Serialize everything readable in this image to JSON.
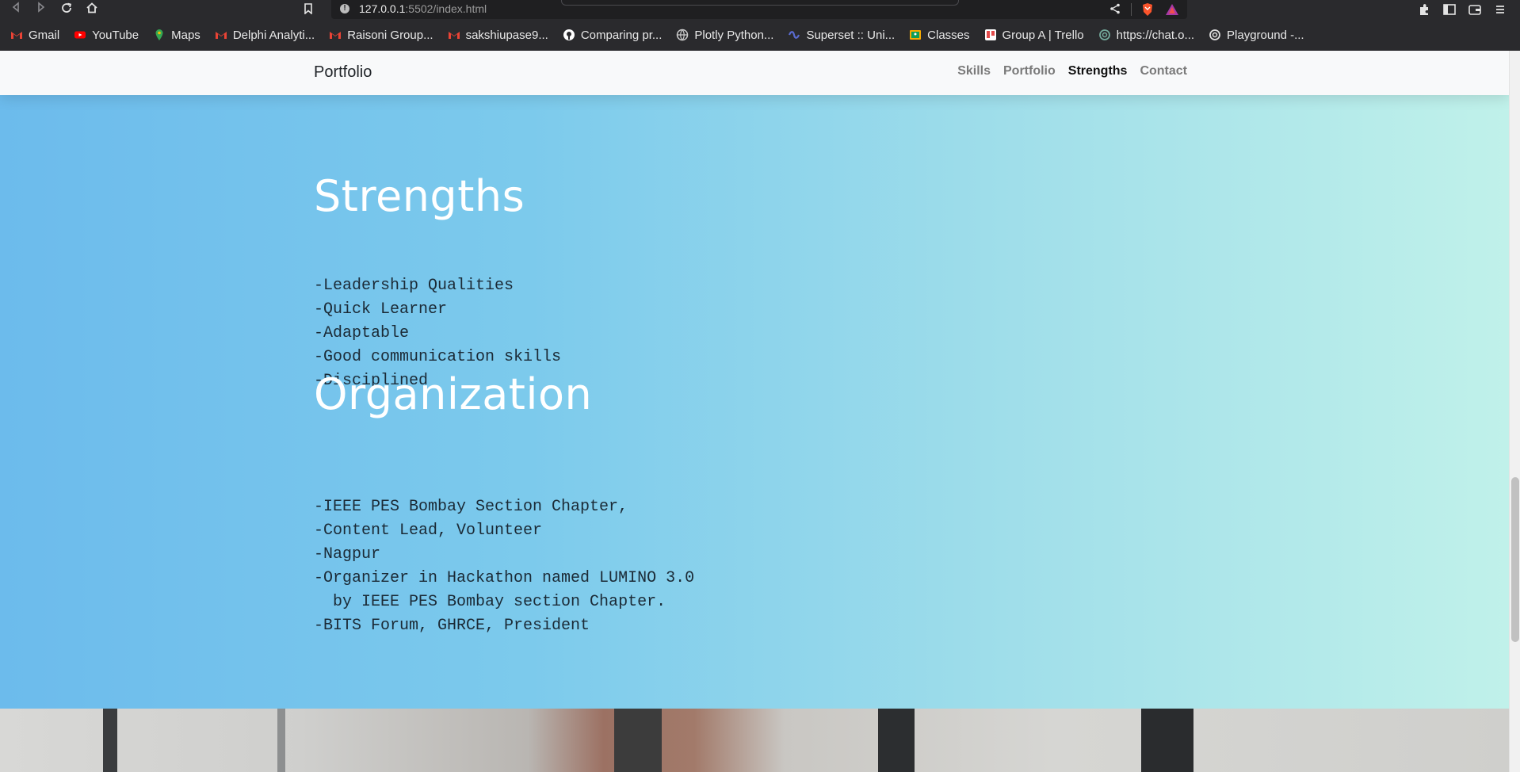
{
  "browser": {
    "url_host": "127.0.0.1",
    "url_rest": ":5502/index.html",
    "bookmarks": [
      {
        "label": "Gmail",
        "icon": "gmail-icon",
        "color": "#EA4335"
      },
      {
        "label": "YouTube",
        "icon": "youtube-icon",
        "color": "#FF0000"
      },
      {
        "label": "Maps",
        "icon": "maps-icon",
        "color": "#34A853"
      },
      {
        "label": "Delphi Analyti...",
        "icon": "gmail-icon",
        "color": "#EA4335"
      },
      {
        "label": "Raisoni Group...",
        "icon": "gmail-icon",
        "color": "#EA4335"
      },
      {
        "label": "sakshiupase9...",
        "icon": "gmail-icon",
        "color": "#EA4335"
      },
      {
        "label": "Comparing pr...",
        "icon": "github-icon",
        "color": "#ffffff"
      },
      {
        "label": "Plotly Python...",
        "icon": "globe-icon",
        "color": "#cccccc"
      },
      {
        "label": "Superset :: Uni...",
        "icon": "superset-icon",
        "color": "#5a6bd0"
      },
      {
        "label": "Classes",
        "icon": "classroom-icon",
        "color": "#F9AB00"
      },
      {
        "label": "Group A | Trello",
        "icon": "trello-icon",
        "color": "#e34b4b"
      },
      {
        "label": "https://chat.o...",
        "icon": "openai-icon",
        "color": "#74aa9c"
      },
      {
        "label": "Playground -...",
        "icon": "openai-icon",
        "color": "#dddddd"
      }
    ]
  },
  "site": {
    "brand": "Portfolio",
    "nav": [
      {
        "label": "Skills",
        "active": false
      },
      {
        "label": "Portfolio",
        "active": false
      },
      {
        "label": "Strengths",
        "active": true
      },
      {
        "label": "Contact",
        "active": false
      }
    ],
    "strengths": {
      "title": "Strengths",
      "items": [
        "-Leadership Qualities",
        "-Quick Learner",
        "-Adaptable",
        "-Good communication skills",
        "-Disciplined"
      ]
    },
    "organization": {
      "title": "Organization",
      "items": [
        "-IEEE PES Bombay Section Chapter,",
        "-Content Lead, Volunteer",
        "-Nagpur",
        "-Organizer in Hackathon named LUMINO 3.0",
        "  by IEEE PES Bombay section Chapter.",
        "-BITS Forum, GHRCE, President"
      ]
    }
  },
  "colors": {
    "gradient_start": "#6cbbec",
    "gradient_end": "#c0f1ea",
    "heading": "#ffffff",
    "list_text": "#1b2a36"
  }
}
